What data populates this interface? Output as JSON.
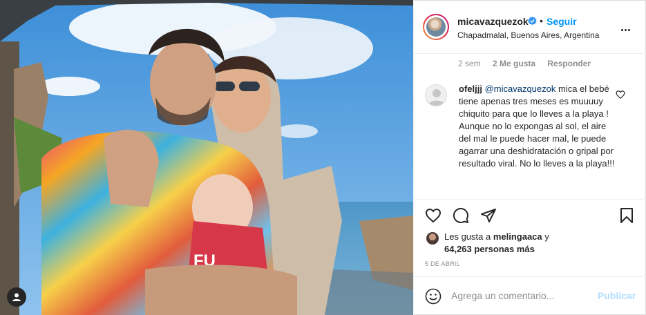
{
  "post": {
    "username": "micavazquezok",
    "follow_separator": "•",
    "follow_label": "Seguir",
    "location": "Chapadmalal, Buenos Aires, Argentina",
    "photo_text": "FU"
  },
  "comment_meta": {
    "time": "2 sem",
    "likes": "2 Me gusta",
    "reply": "Responder"
  },
  "comment": {
    "username": "ofeljjj",
    "mention": "@micavazquezok",
    "text": " mica el bebé tiene apenas tres meses es muuuuy chiquito para que lo lleves a la playa ! Aunque no lo expongas al sol, el aire del mal le puede hacer mal, le puede agarrar una deshidratación o gripal por resultado viral. No lo lleves a la playa!!!"
  },
  "likes_summary": {
    "prefix": "Les gusta a ",
    "first_liker": "melingaaca",
    "connector": " y",
    "count_text": "64,263 personas más"
  },
  "date": "5 DE ABRIL",
  "add_comment": {
    "placeholder": "Agrega un comentario...",
    "publish_label": "Publicar"
  },
  "icons": [
    "verified-badge-icon",
    "more-options-icon",
    "heart-icon",
    "comment-icon",
    "share-icon",
    "bookmark-icon",
    "emoji-icon",
    "user-tag-icon"
  ],
  "colors": {
    "accent": "#0095f6",
    "text": "#262626",
    "muted": "#8e8e8e",
    "publish_disabled": "#b2dffc",
    "mention": "#00376b"
  }
}
